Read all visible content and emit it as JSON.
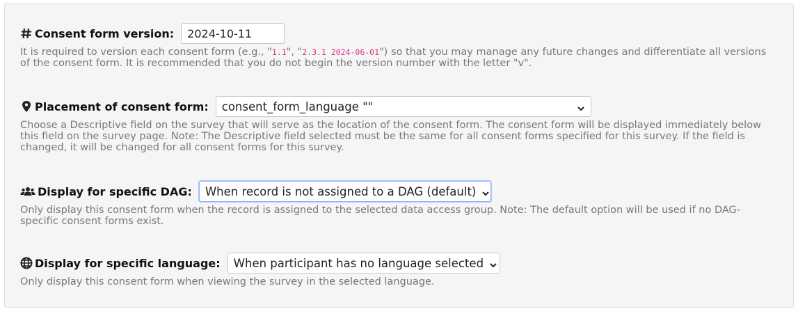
{
  "version": {
    "icon": "hash-icon",
    "label": "Consent form version:",
    "value": "2024-10-11",
    "hint_pre": "It is required to version each consent form (e.g., \"",
    "code1": "1.1",
    "hint_mid": "\", \"",
    "code2": "2.3.1 2024-06-01",
    "hint_post": "\") so that you may manage any future changes and differentiate all versions of the consent form. It is recommended that you do not begin the version number with the letter \"v\"."
  },
  "placement": {
    "icon": "map-marker-icon",
    "label": "Placement of consent form:",
    "selected": "consent_form_language \"\"",
    "hint": "Choose a Descriptive field on the survey that will serve as the location of the consent form. The consent form will be displayed immediately below this field on the survey page. Note: The Descriptive field selected must be the same for all consent forms specified for this survey. If the field is changed, it will be changed for all consent forms for this survey."
  },
  "dag": {
    "icon": "users-icon",
    "label": "Display for specific DAG:",
    "selected": "When record is not assigned to a DAG (default)",
    "hint": "Only display this consent form when the record is assigned to the selected data access group. Note: The default option will be used if no DAG-specific consent forms exist."
  },
  "language": {
    "icon": "globe-icon",
    "label": "Display for specific language:",
    "selected": "When participant has no language selected",
    "hint": "Only display this consent form when viewing the survey in the selected language."
  }
}
